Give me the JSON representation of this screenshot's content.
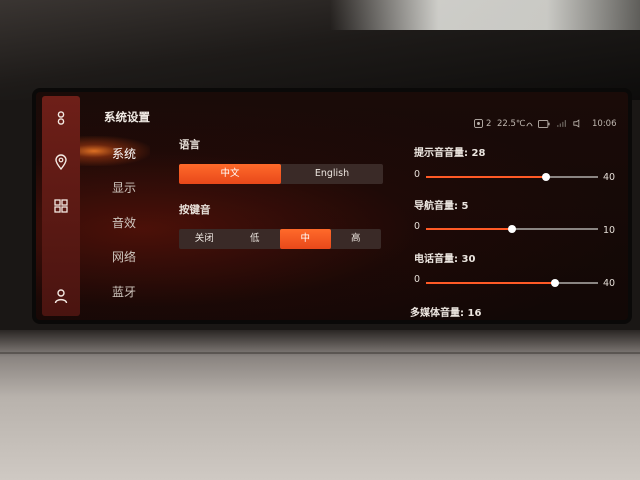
{
  "sidebar": {
    "title": "系统设置",
    "items": [
      {
        "label": "系统",
        "active": true
      },
      {
        "label": "显示",
        "active": false
      },
      {
        "label": "音效",
        "active": false
      },
      {
        "label": "网络",
        "active": false
      },
      {
        "label": "蓝牙",
        "active": false
      }
    ]
  },
  "rail_icons": [
    "link-icon",
    "location-pin-icon",
    "apps-grid-icon",
    "user-icon"
  ],
  "status_bar": {
    "fan_level": "2",
    "temperature": "22.5℃",
    "time": "10:06"
  },
  "language": {
    "label": "语言",
    "options": [
      "中文",
      "English"
    ],
    "selected": "中文"
  },
  "key_tone": {
    "label": "按键音",
    "options": [
      "关闭",
      "低",
      "中",
      "高"
    ],
    "selected": "中"
  },
  "volumes": [
    {
      "label": "提示音音量:",
      "value": "28",
      "min": "0",
      "max": "40",
      "fraction": 0.7
    },
    {
      "label": "导航音量:",
      "value": "5",
      "min": "0",
      "max": "10",
      "fraction": 0.5
    },
    {
      "label": "电话音量:",
      "value": "30",
      "min": "0",
      "max": "40",
      "fraction": 0.75
    },
    {
      "label": "多媒体音量:",
      "value": "16"
    }
  ],
  "colors": {
    "accent": "#f2521f",
    "rail": "#5c1a14",
    "screen_bg": "#160a07"
  }
}
